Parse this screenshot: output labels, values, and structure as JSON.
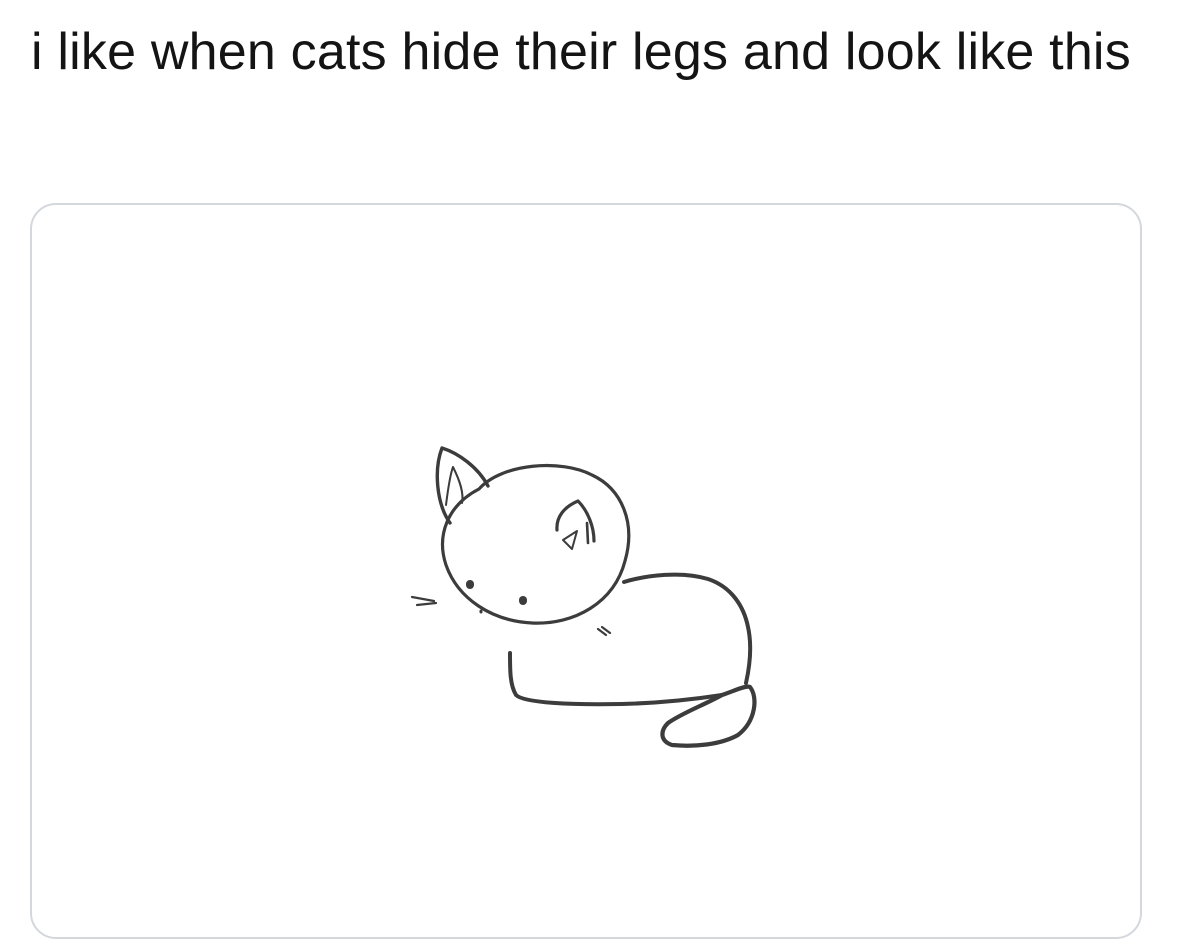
{
  "tweet": {
    "text": "i like when cats hide their legs and look like this"
  },
  "media": {
    "image_name": "cat-sketch-no-legs",
    "background": "#ffffff",
    "border_color": "#d4d8dc",
    "line_color": "#3c3c3c"
  }
}
